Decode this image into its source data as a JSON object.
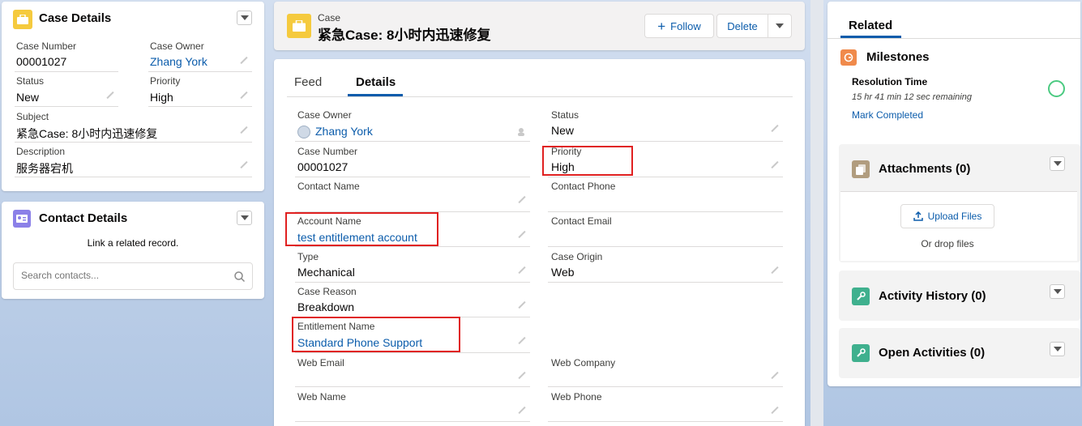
{
  "case_details": {
    "title": "Case Details",
    "case_number_label": "Case Number",
    "case_number": "00001027",
    "case_owner_label": "Case Owner",
    "case_owner": "Zhang York",
    "status_label": "Status",
    "status": "New",
    "priority_label": "Priority",
    "priority": "High",
    "subject_label": "Subject",
    "subject": "紧急Case: 8小时内迅速修复",
    "description_label": "Description",
    "description": "服务器宕机"
  },
  "contact_details": {
    "title": "Contact Details",
    "link_text": "Link a related record.",
    "search_placeholder": "Search contacts..."
  },
  "header": {
    "object_label": "Case",
    "record_title": "紧急Case: 8小时内迅速修复",
    "follow_label": "Follow",
    "delete_label": "Delete"
  },
  "tabs": {
    "feed": "Feed",
    "details": "Details"
  },
  "details": {
    "case_owner_label": "Case Owner",
    "case_owner": "Zhang York",
    "status_label": "Status",
    "status": "New",
    "case_number_label": "Case Number",
    "case_number": "00001027",
    "priority_label": "Priority",
    "priority": "High",
    "contact_name_label": "Contact Name",
    "contact_phone_label": "Contact Phone",
    "account_name_label": "Account Name",
    "account_name": "test entitlement account",
    "contact_email_label": "Contact Email",
    "type_label": "Type",
    "type": "Mechanical",
    "case_origin_label": "Case Origin",
    "case_origin": "Web",
    "case_reason_label": "Case Reason",
    "case_reason": "Breakdown",
    "entitlement_name_label": "Entitlement Name",
    "entitlement_name": "Standard Phone Support",
    "web_email_label": "Web Email",
    "web_company_label": "Web Company",
    "web_name_label": "Web Name",
    "web_phone_label": "Web Phone"
  },
  "related": {
    "tab_label": "Related",
    "milestones_title": "Milestones",
    "milestone_name": "Resolution Time",
    "milestone_remaining": "15 hr 41 min 12 sec remaining",
    "mark_completed": "Mark Completed",
    "attachments_title": "Attachments (0)",
    "upload_label": "Upload Files",
    "drop_label": "Or drop files",
    "activity_history_title": "Activity History (0)",
    "open_activities_title": "Open Activities (0)"
  },
  "colors": {
    "case_icon": "#f5ca3e",
    "contact_icon": "#8b80e8",
    "milestone_icon": "#f08a4b",
    "attachment_icon": "#b19d7f",
    "activity_icon": "#3fb08e",
    "link": "#0b5cab",
    "highlight": "#e02020"
  }
}
